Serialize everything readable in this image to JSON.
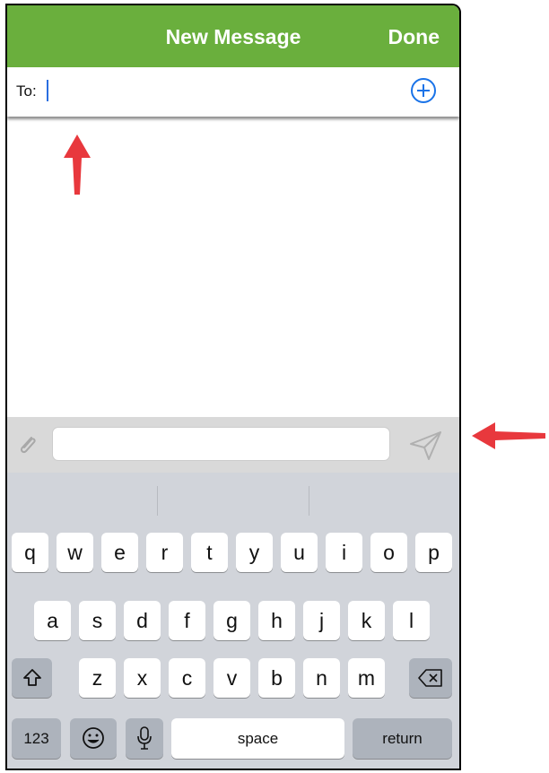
{
  "header": {
    "title": "New Message",
    "done_label": "Done"
  },
  "recipient": {
    "label": "To:",
    "value": ""
  },
  "compose": {
    "message_value": ""
  },
  "keyboard": {
    "row1": [
      "q",
      "w",
      "e",
      "r",
      "t",
      "y",
      "u",
      "i",
      "o",
      "p"
    ],
    "row2": [
      "a",
      "s",
      "d",
      "f",
      "g",
      "h",
      "j",
      "k",
      "l"
    ],
    "row3": [
      "z",
      "x",
      "c",
      "v",
      "b",
      "n",
      "m"
    ],
    "numbers_label": "123",
    "space_label": "space",
    "return_label": "return"
  },
  "icons": [
    "add-recipient-icon",
    "attachment-icon",
    "send-icon",
    "shift-icon",
    "delete-icon",
    "emoji-icon",
    "microphone-icon",
    "arrow-icon"
  ],
  "colors": {
    "header": "#6aaf3d",
    "accent": "#1a73e8",
    "annotation_arrow": "#e8383d"
  }
}
